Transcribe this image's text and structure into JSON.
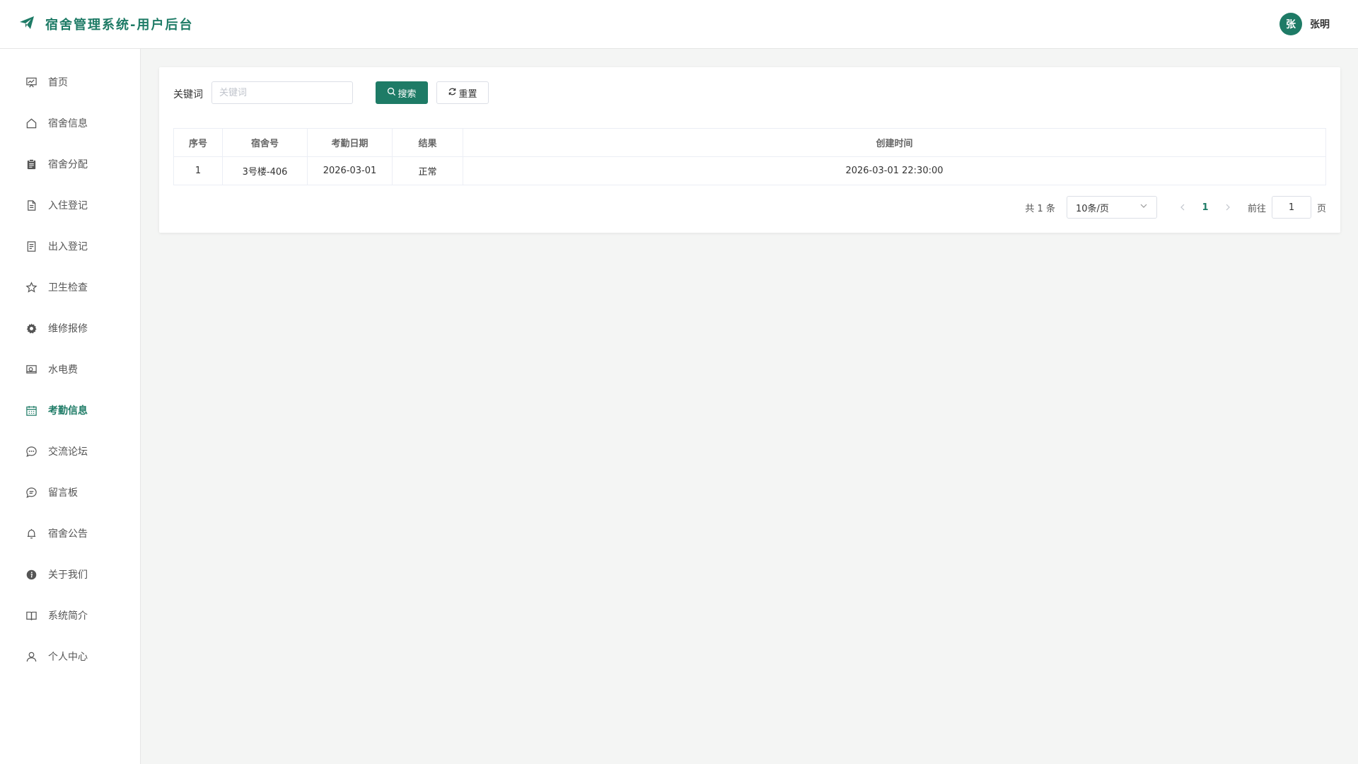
{
  "header": {
    "app_title": "宿舍管理系统-用户后台",
    "logo_icon": "paper-plane-icon",
    "user": {
      "avatar_text": "张",
      "name": "张明"
    }
  },
  "colors": {
    "accent": "#1e7b66",
    "background": "#f4f5f4"
  },
  "sidebar": {
    "items": [
      {
        "label": "首页",
        "icon": "chart-board-icon"
      },
      {
        "label": "宿舍信息",
        "icon": "home-icon"
      },
      {
        "label": "宿舍分配",
        "icon": "clipboard-icon"
      },
      {
        "label": "入住登记",
        "icon": "document-icon"
      },
      {
        "label": "出入登记",
        "icon": "document-list-icon"
      },
      {
        "label": "卫生检查",
        "icon": "star-icon"
      },
      {
        "label": "维修报修",
        "icon": "gear-icon"
      },
      {
        "label": "水电费",
        "icon": "money-icon"
      },
      {
        "label": "考勤信息",
        "icon": "calendar-icon",
        "active": true
      },
      {
        "label": "交流论坛",
        "icon": "chat-dots-icon"
      },
      {
        "label": "留言板",
        "icon": "chat-lines-icon"
      },
      {
        "label": "宿舍公告",
        "icon": "bell-icon"
      },
      {
        "label": "关于我们",
        "icon": "info-icon"
      },
      {
        "label": "系统简介",
        "icon": "book-icon"
      },
      {
        "label": "个人中心",
        "icon": "user-icon"
      }
    ]
  },
  "search": {
    "label": "关键词",
    "placeholder": "关键词",
    "search_button": "搜索",
    "reset_button": "重置"
  },
  "table": {
    "columns": [
      "序号",
      "宿舍号",
      "考勤日期",
      "结果",
      "创建时间"
    ],
    "rows": [
      [
        "1",
        "3号楼-406",
        "2026-03-01",
        "正常",
        "2026-03-01 22:30:00"
      ]
    ]
  },
  "pagination": {
    "total_text": "共 1 条",
    "page_size": "10条/页",
    "current_page": "1",
    "goto_label": "前往",
    "goto_value": "1",
    "page_unit": "页"
  }
}
